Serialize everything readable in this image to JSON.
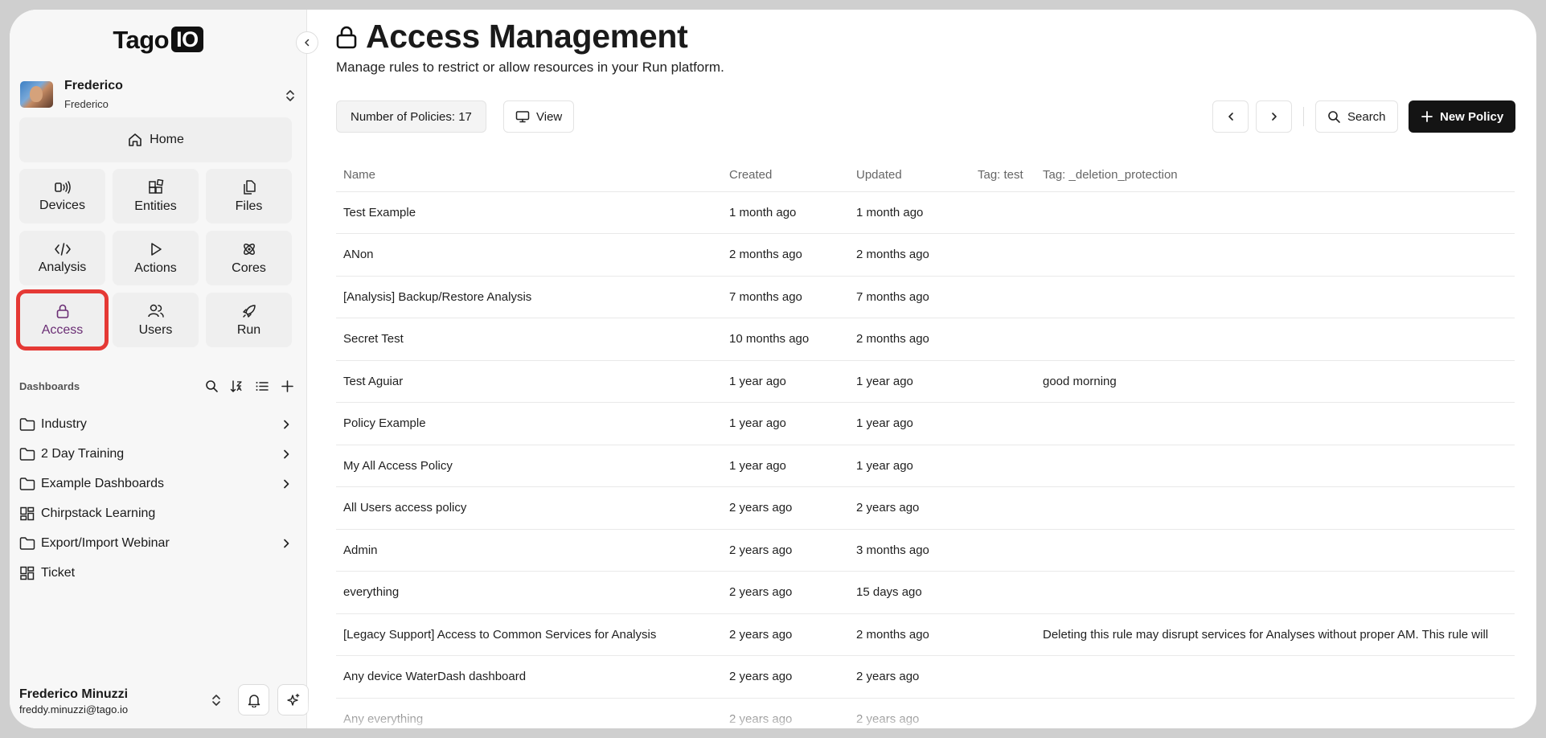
{
  "app": {
    "logo_text": "Tago",
    "logo_badge": "IO"
  },
  "profile": {
    "name": "Frederico",
    "sub": "Frederico"
  },
  "sidebar": {
    "home_label": "Home",
    "tiles": [
      {
        "label": "Devices",
        "icon": "devices-icon"
      },
      {
        "label": "Entities",
        "icon": "entities-icon"
      },
      {
        "label": "Files",
        "icon": "files-icon"
      },
      {
        "label": "Analysis",
        "icon": "code-icon"
      },
      {
        "label": "Actions",
        "icon": "play-icon"
      },
      {
        "label": "Cores",
        "icon": "cores-icon"
      },
      {
        "label": "Access",
        "icon": "lock-icon",
        "active": true
      },
      {
        "label": "Users",
        "icon": "users-icon"
      },
      {
        "label": "Run",
        "icon": "rocket-icon"
      }
    ],
    "dashboards_title": "Dashboards",
    "dashboards": [
      {
        "label": "Industry",
        "type": "folder",
        "expandable": true
      },
      {
        "label": "2 Day Training",
        "type": "folder",
        "expandable": true
      },
      {
        "label": "Example Dashboards",
        "type": "folder",
        "expandable": true
      },
      {
        "label": "Chirpstack Learning",
        "type": "dashboard",
        "expandable": false
      },
      {
        "label": "Export/Import Webinar",
        "type": "folder",
        "expandable": true
      },
      {
        "label": "Ticket",
        "type": "dashboard",
        "expandable": false
      }
    ]
  },
  "user": {
    "name": "Frederico Minuzzi",
    "email": "freddy.minuzzi@tago.io"
  },
  "page": {
    "title": "Access Management",
    "subtitle": "Manage rules to restrict or allow resources in your Run platform."
  },
  "toolbar": {
    "count_label": "Number of Policies: 17",
    "view_label": "View",
    "search_label": "Search",
    "new_label": "New Policy"
  },
  "table": {
    "columns": [
      "Name",
      "Created",
      "Updated",
      "Tag: test",
      "Tag: _deletion_protection"
    ],
    "rows": [
      [
        "Test Example",
        "1 month ago",
        "1 month ago",
        "",
        ""
      ],
      [
        "ANon",
        "2 months ago",
        "2 months ago",
        "",
        ""
      ],
      [
        "[Analysis] Backup/Restore Analysis",
        "7 months ago",
        "7 months ago",
        "",
        ""
      ],
      [
        "Secret Test",
        "10 months ago",
        "2 months ago",
        "",
        ""
      ],
      [
        "Test Aguiar",
        "1 year ago",
        "1 year ago",
        "",
        "good morning"
      ],
      [
        "Policy Example",
        "1 year ago",
        "1 year ago",
        "",
        ""
      ],
      [
        "My All Access Policy",
        "1 year ago",
        "1 year ago",
        "",
        ""
      ],
      [
        "All Users access policy",
        "2 years ago",
        "2 years ago",
        "",
        ""
      ],
      [
        "Admin",
        "2 years ago",
        "3 months ago",
        "",
        ""
      ],
      [
        "everything",
        "2 years ago",
        "15 days ago",
        "",
        ""
      ],
      [
        "[Legacy Support] Access to Common Services for Analysis",
        "2 years ago",
        "2 months ago",
        "",
        "Deleting this rule may disrupt services for Analyses without proper AM. This rule will"
      ],
      [
        "Any device WaterDash dashboard",
        "2 years ago",
        "2 years ago",
        "",
        ""
      ],
      [
        "Any everything",
        "2 years ago",
        "2 years ago",
        "",
        ""
      ]
    ]
  },
  "colors": {
    "accent_active": "#6a2d74",
    "highlight_outline": "#e53935",
    "primary_button": "#141414"
  }
}
